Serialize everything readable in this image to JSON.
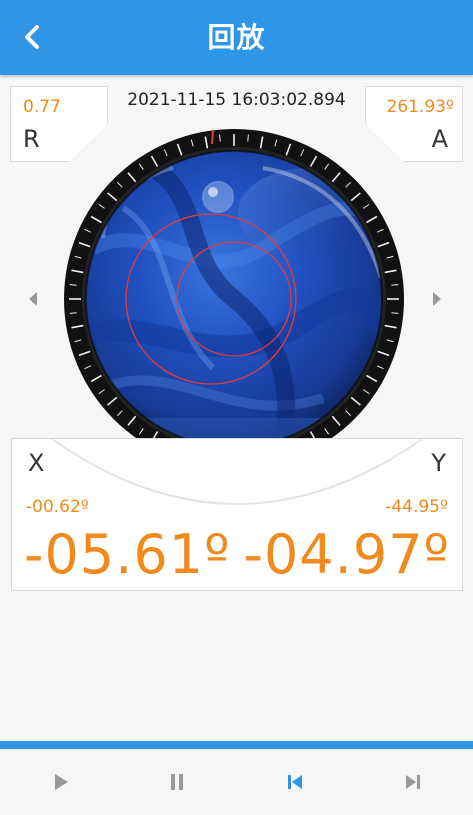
{
  "header": {
    "title": "回放",
    "back_icon": "chevron-left-icon"
  },
  "timestamp": "2021-11-15 16:03:02.894",
  "readings": {
    "r": {
      "label": "R",
      "value": "0.77"
    },
    "a": {
      "label": "A",
      "value": "261.93º"
    },
    "x": {
      "label": "X",
      "small": "-00.62º",
      "big": "-05.61º"
    },
    "y": {
      "label": "Y",
      "small": "-44.95º",
      "big": "-04.97º"
    }
  },
  "controls": [
    {
      "name": "play",
      "icon": "play-icon"
    },
    {
      "name": "pause",
      "icon": "pause-icon"
    },
    {
      "name": "skip-to-start",
      "icon": "skip-start-icon"
    },
    {
      "name": "skip-to-end",
      "icon": "skip-end-icon"
    }
  ],
  "colors": {
    "header": "#2f95e6",
    "accent": "#f08a1c",
    "active_control": "#2f95e6",
    "ring": "#e23b3b"
  }
}
